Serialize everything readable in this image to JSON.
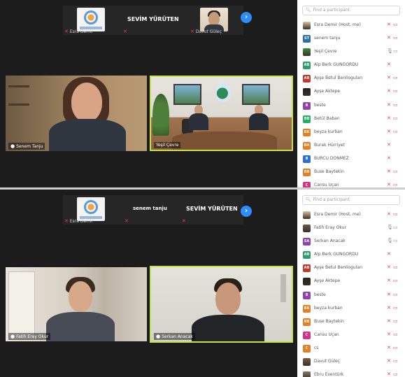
{
  "colors": {
    "accent_blue": "#2d8cff",
    "mic_muted": "#e04040",
    "active_speaker_border": "#c6e24a",
    "meeting_bg": "#1c1c1c"
  },
  "top": {
    "strip": {
      "tile1_name": "Esra Demir",
      "label": "SEVİM YÜRÜTEN",
      "tile3_name": "Davut Güleç"
    },
    "video_left_name": "Senem Tanju",
    "video_right_name": "Yeşil Çevre",
    "search_placeholder": "Find a participant",
    "participants": [
      {
        "name": "Esra Demir (Host, me)",
        "initials": "",
        "color": "#d9c3a1",
        "mic": "muted",
        "cam": "off",
        "avatar_type": "image"
      },
      {
        "name": "senem tanju",
        "initials": "ST",
        "color": "#2f6fa8",
        "mic": "muted",
        "cam": "off",
        "avatar_type": "initials"
      },
      {
        "name": "Yeşil Çevre",
        "initials": "",
        "color": "#3b8f3b",
        "mic": "on",
        "cam": "on",
        "avatar_type": "image"
      },
      {
        "name": "Alp Berk GÜNGÖRDÜ",
        "initials": "AB",
        "color": "#2e9e6e",
        "mic": "muted",
        "cam": "",
        "avatar_type": "initials"
      },
      {
        "name": "Ayşe Betul Benlioguları",
        "initials": "AB",
        "color": "#c0392b",
        "mic": "muted",
        "cam": "off",
        "avatar_type": "initials"
      },
      {
        "name": "Ayşe Aktepe",
        "initials": "",
        "color": "#222222",
        "mic": "muted",
        "cam": "off",
        "avatar_type": "image"
      },
      {
        "name": "beste",
        "initials": "B",
        "color": "#8e44ad",
        "mic": "muted",
        "cam": "off",
        "avatar_type": "initials"
      },
      {
        "name": "Betül Baban",
        "initials": "BB",
        "color": "#27ae60",
        "mic": "muted",
        "cam": "off",
        "avatar_type": "initials"
      },
      {
        "name": "beyza kurban",
        "initials": "BK",
        "color": "#e67e22",
        "mic": "muted",
        "cam": "off",
        "avatar_type": "initials"
      },
      {
        "name": "Burak Hürriyet",
        "initials": "BH",
        "color": "#e67e22",
        "mic": "muted",
        "cam": "",
        "avatar_type": "initials"
      },
      {
        "name": "BURCU DÖNMEZ",
        "initials": "B",
        "color": "#2d6fd6",
        "mic": "muted",
        "cam": "",
        "avatar_type": "initials"
      },
      {
        "name": "Buse Baytekin",
        "initials": "BB",
        "color": "#e67e22",
        "mic": "muted",
        "cam": "off",
        "avatar_type": "initials"
      },
      {
        "name": "Cansu Uçan",
        "initials": "C",
        "color": "#d63384",
        "mic": "muted",
        "cam": "off",
        "avatar_type": "initials"
      }
    ]
  },
  "bottom": {
    "strip": {
      "tile1_name": "Esra Demir",
      "label_a": "senem tanju",
      "label_b": "SEVİM YÜRÜTEN"
    },
    "video_left_name": "Fatih Eray Okur",
    "video_right_name": "Serkan Anacak",
    "search_placeholder": "Find a participant",
    "participants": [
      {
        "name": "Esra Demir (Host, me)",
        "initials": "",
        "color": "#d9c3a1",
        "mic": "muted",
        "cam": "off",
        "avatar_type": "image"
      },
      {
        "name": "Fatih Eray Okur",
        "initials": "",
        "color": "#6b5a4a",
        "mic": "on",
        "cam": "on",
        "avatar_type": "image"
      },
      {
        "name": "Serkan Anacak",
        "initials": "SA",
        "color": "#8e44ad",
        "mic": "on",
        "cam": "on",
        "avatar_type": "initials"
      },
      {
        "name": "Alp Berk GÜNGÖRDÜ",
        "initials": "AB",
        "color": "#2e9e6e",
        "mic": "muted",
        "cam": "",
        "avatar_type": "initials"
      },
      {
        "name": "Ayşe Betul Benlioguları",
        "initials": "AB",
        "color": "#c0392b",
        "mic": "muted",
        "cam": "off",
        "avatar_type": "initials"
      },
      {
        "name": "Ayşe Aktepe",
        "initials": "",
        "color": "#222222",
        "mic": "muted",
        "cam": "off",
        "avatar_type": "image"
      },
      {
        "name": "beste",
        "initials": "B",
        "color": "#8e44ad",
        "mic": "muted",
        "cam": "off",
        "avatar_type": "initials"
      },
      {
        "name": "beyza kurban",
        "initials": "BK",
        "color": "#e67e22",
        "mic": "muted",
        "cam": "off",
        "avatar_type": "initials"
      },
      {
        "name": "Buse Baytekin",
        "initials": "BB",
        "color": "#e67e22",
        "mic": "muted",
        "cam": "off",
        "avatar_type": "initials"
      },
      {
        "name": "Cansu Uçan",
        "initials": "C",
        "color": "#d63384",
        "mic": "muted",
        "cam": "off",
        "avatar_type": "initials"
      },
      {
        "name": "cs",
        "initials": "C",
        "color": "#e67e22",
        "mic": "muted",
        "cam": "off",
        "avatar_type": "initials"
      },
      {
        "name": "Davut Güleç",
        "initials": "",
        "color": "#7a5a44",
        "mic": "muted",
        "cam": "off",
        "avatar_type": "image"
      },
      {
        "name": "Ebru Esentürk",
        "initials": "",
        "color": "#8a7a6a",
        "mic": "muted",
        "cam": "off",
        "avatar_type": "image"
      }
    ]
  }
}
